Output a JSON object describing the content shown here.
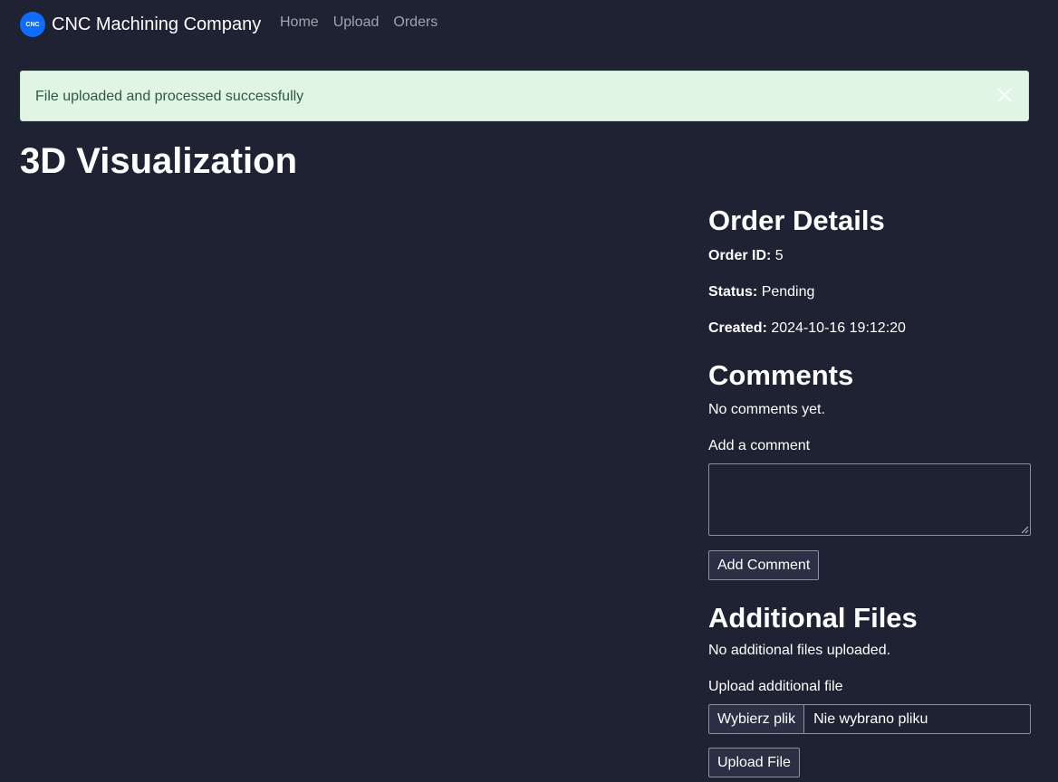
{
  "navbar": {
    "logo_text": "CNC",
    "brand": "CNC Machining Company",
    "links": [
      "Home",
      "Upload",
      "Orders"
    ]
  },
  "alert": {
    "message": "File uploaded and processed successfully"
  },
  "page": {
    "title": "3D Visualization"
  },
  "order": {
    "heading": "Order Details",
    "id_label": "Order ID:",
    "id_value": "5",
    "status_label": "Status:",
    "status_value": "Pending",
    "created_label": "Created:",
    "created_value": "2024-10-16 19:12:20"
  },
  "comments": {
    "heading": "Comments",
    "empty_text": "No comments yet.",
    "field_label": "Add a comment",
    "field_value": "",
    "submit_label": "Add Comment"
  },
  "files": {
    "heading": "Additional Files",
    "empty_text": "No additional files uploaded.",
    "field_label": "Upload additional file",
    "choose_label": "Wybierz plik",
    "no_file_text": "Nie wybrano pliku",
    "submit_label": "Upload File"
  },
  "colors": {
    "background": "#1e2233",
    "alert_bg": "#e1f5e4",
    "alert_text": "#2f5a3a",
    "logo": "#0d6efd",
    "nav_link": "#a1a4ab"
  },
  "icons": {
    "alert_close": "close-icon",
    "textarea_resize": "resize-grip-icon"
  }
}
